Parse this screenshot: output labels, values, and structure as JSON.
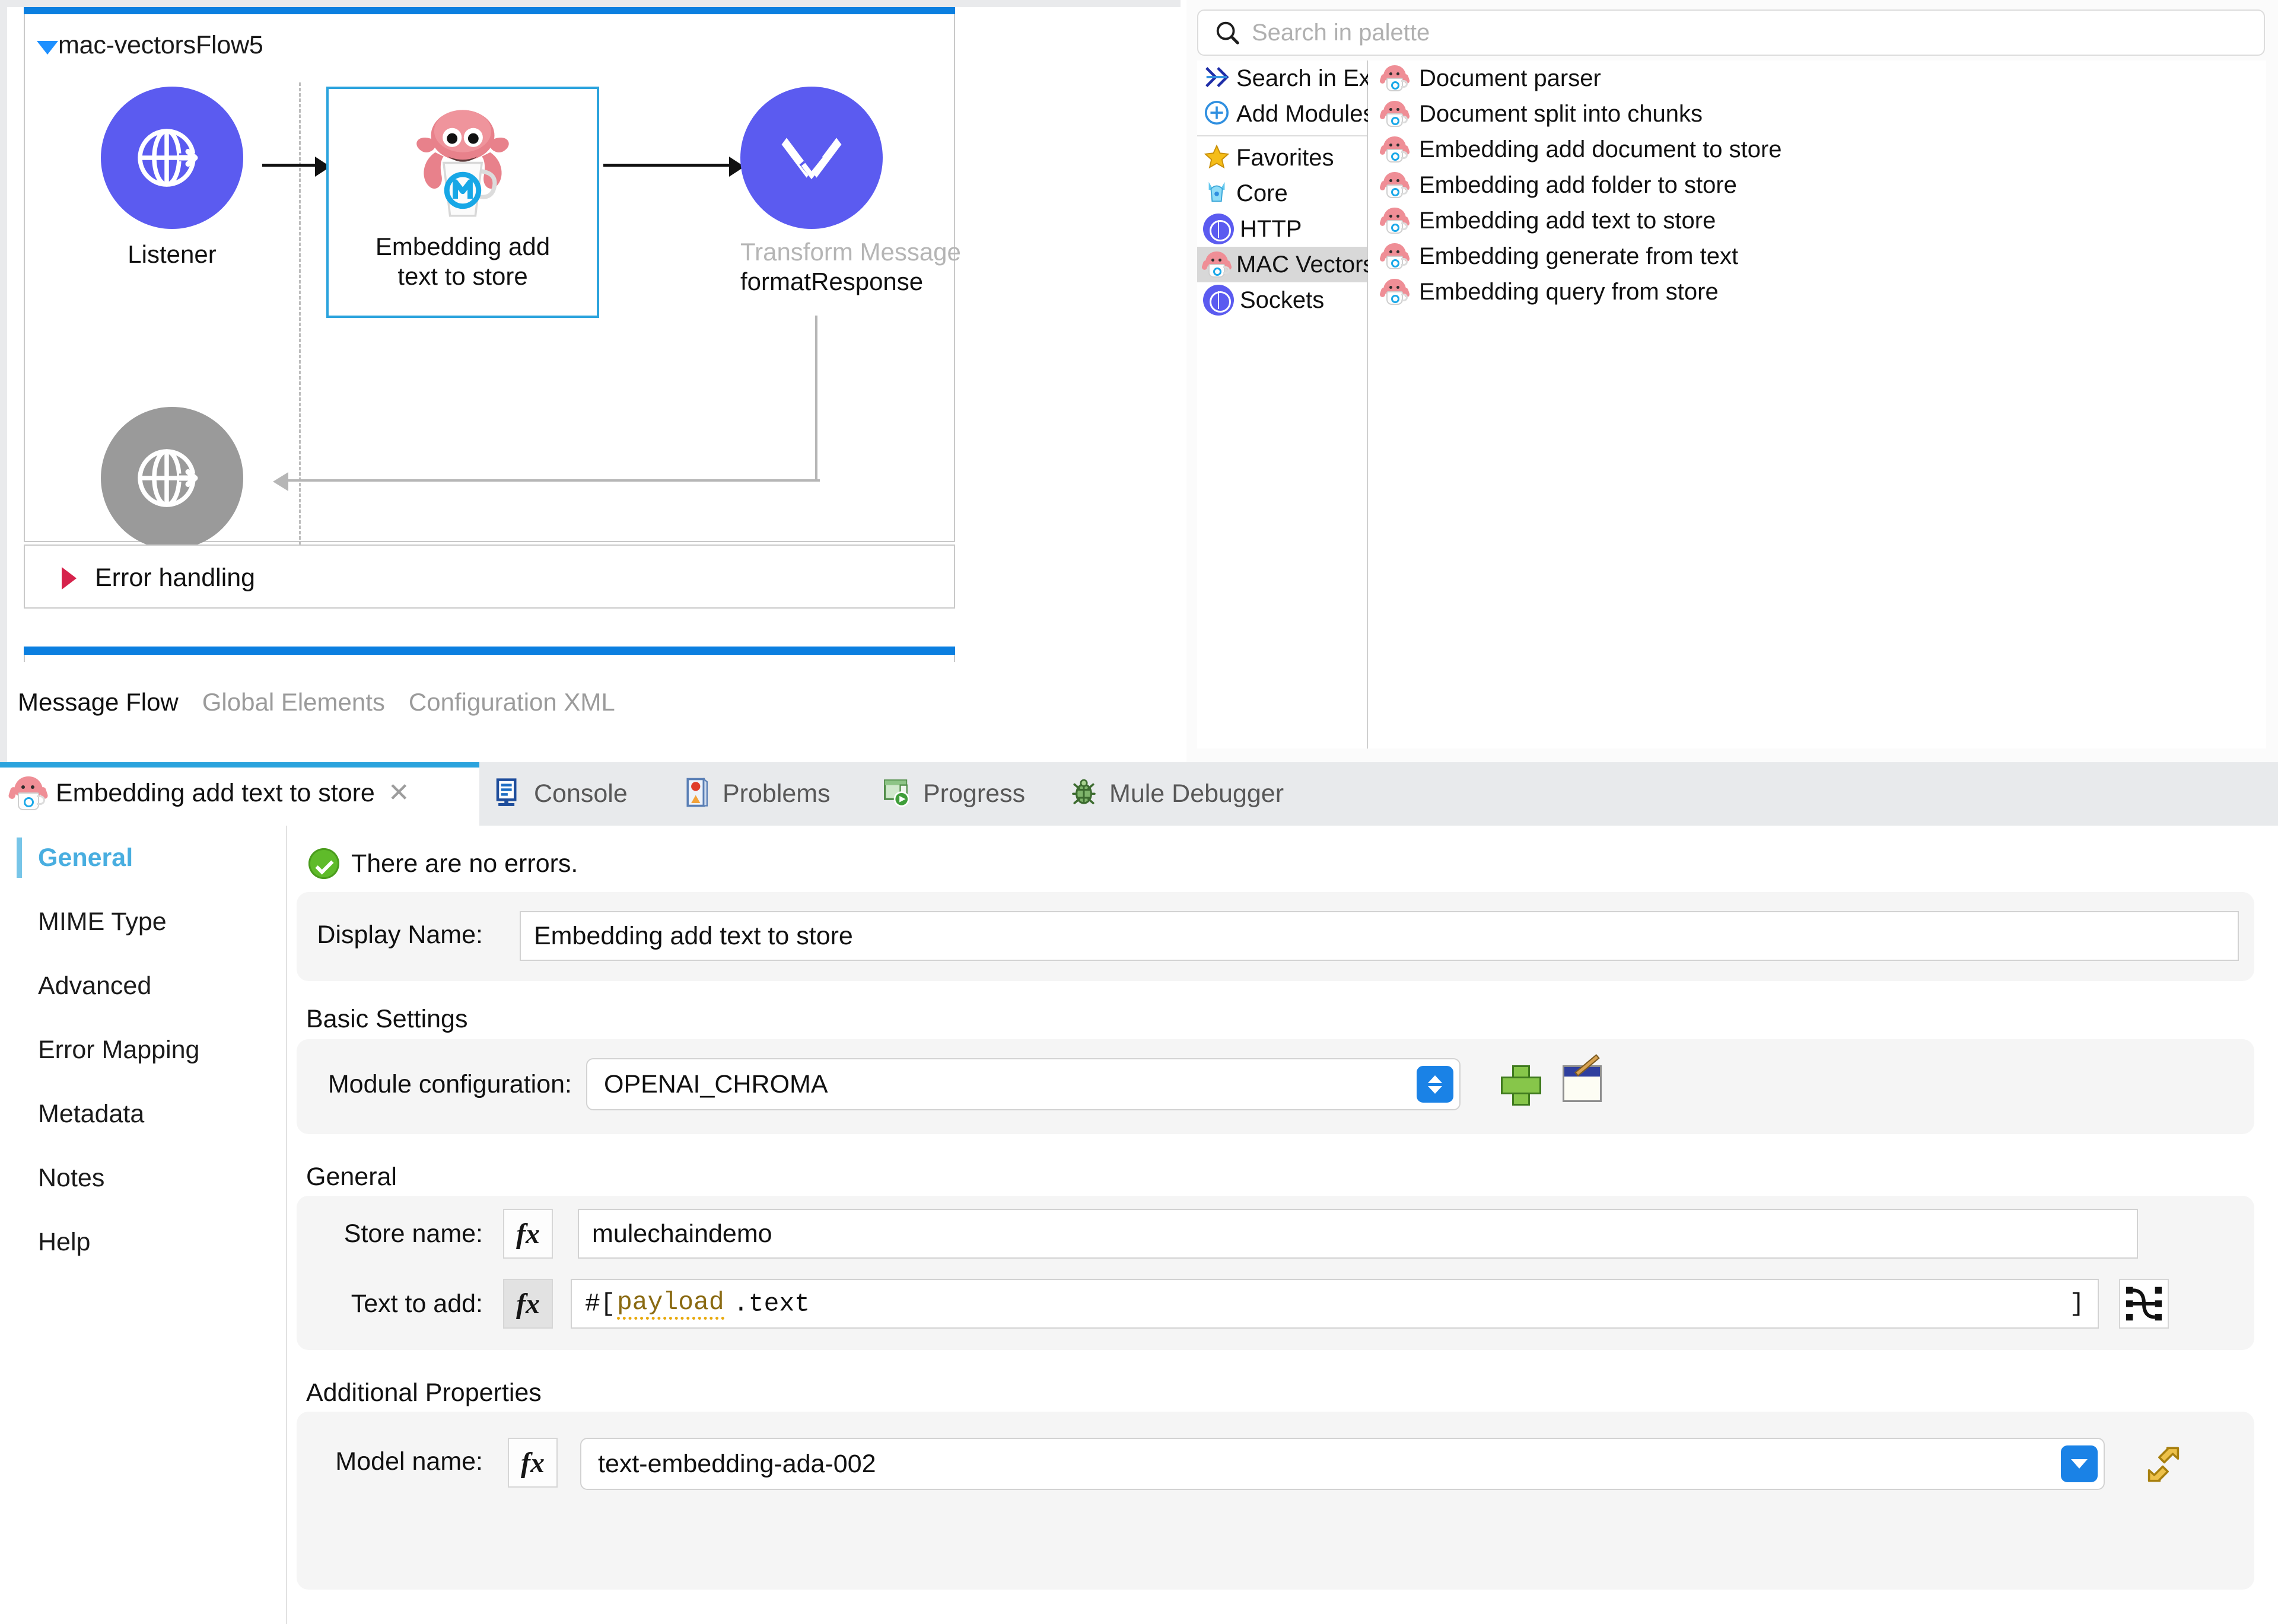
{
  "canvas": {
    "flow_name": "mac-vectorsFlow5",
    "nodes": [
      {
        "id": "listener",
        "label": "Listener",
        "icon": "globe-arrow-icon",
        "state": "enabled"
      },
      {
        "id": "embedding-add-text-to-store",
        "label_line1": "Embedding add",
        "label_line2": "text to store",
        "icon": "mac-octopus-icon",
        "state": "selected"
      },
      {
        "id": "transform-message",
        "label_line1": "Transform Message",
        "label_line2": "formatResponse",
        "icon": "dataweave-icon",
        "state": "enabled"
      },
      {
        "id": "listener-response",
        "label": "",
        "icon": "globe-arrow-icon",
        "state": "disabled"
      }
    ],
    "error_handling_label": "Error handling",
    "editor_tabs": [
      {
        "label": "Message Flow",
        "selected": true
      },
      {
        "label": "Global Elements",
        "selected": false
      },
      {
        "label": "Configuration XML",
        "selected": false
      }
    ]
  },
  "palette": {
    "search_placeholder": "Search in palette",
    "search_value": "",
    "categories": [
      {
        "label": "Search in Exchange..",
        "icon": "exchange-icon",
        "selected": false
      },
      {
        "label": "Add Modules",
        "icon": "plus-circle-icon",
        "selected": false
      },
      {
        "label": "Favorites",
        "icon": "star-icon",
        "selected": false
      },
      {
        "label": "Core",
        "icon": "core-icon",
        "selected": false
      },
      {
        "label": "HTTP",
        "icon": "globe-icon",
        "selected": false
      },
      {
        "label": "MAC Vectors",
        "icon": "mac-octopus-icon",
        "selected": true
      },
      {
        "label": "Sockets",
        "icon": "globe-icon",
        "selected": false
      }
    ],
    "operations": [
      {
        "label": "Document parser",
        "icon": "mac-octopus-icon"
      },
      {
        "label": "Document split into chunks",
        "icon": "mac-octopus-icon"
      },
      {
        "label": "Embedding add document to store",
        "icon": "mac-octopus-icon"
      },
      {
        "label": "Embedding add folder to store",
        "icon": "mac-octopus-icon"
      },
      {
        "label": "Embedding add text to store",
        "icon": "mac-octopus-icon"
      },
      {
        "label": "Embedding generate from text",
        "icon": "mac-octopus-icon"
      },
      {
        "label": "Embedding query from store",
        "icon": "mac-octopus-icon"
      }
    ]
  },
  "properties": {
    "active_tab": {
      "label": "Embedding add text to store",
      "icon": "mac-octopus-icon",
      "close": "✕"
    },
    "other_tabs": [
      {
        "label": "Console",
        "icon": "console-icon"
      },
      {
        "label": "Problems",
        "icon": "problems-icon"
      },
      {
        "label": "Progress",
        "icon": "progress-icon"
      },
      {
        "label": "Mule Debugger",
        "icon": "bug-icon"
      }
    ],
    "sidebar": [
      {
        "label": "General",
        "selected": true
      },
      {
        "label": "MIME Type",
        "selected": false
      },
      {
        "label": "Advanced",
        "selected": false
      },
      {
        "label": "Error Mapping",
        "selected": false
      },
      {
        "label": "Metadata",
        "selected": false
      },
      {
        "label": "Notes",
        "selected": false
      },
      {
        "label": "Help",
        "selected": false
      }
    ],
    "status": {
      "text": "There are no errors.",
      "icon": "check-circle-icon"
    },
    "display_name": {
      "label": "Display Name:",
      "value": "Embedding add text to store"
    },
    "sections": {
      "basic_settings": {
        "title": "Basic Settings"
      },
      "general": {
        "title": "General"
      },
      "additional_properties": {
        "title": "Additional Properties"
      }
    },
    "module_configuration": {
      "label": "Module configuration:",
      "value": "OPENAI_CHROMA",
      "add_icon": "plus-green-icon",
      "edit_icon": "edit-config-icon"
    },
    "store_name": {
      "label": "Store name:",
      "value": "mulechaindemo",
      "fx_active": false,
      "fx_label": "fx"
    },
    "text_to_add": {
      "label": "Text to add:",
      "prefix": "#[",
      "token": "payload",
      "rest": ".text",
      "suffix": "]",
      "fx_active": true,
      "fx_label": "fx",
      "mapper_icon": "datasense-mapper-icon"
    },
    "model_name": {
      "label": "Model name:",
      "value": "text-embedding-ada-002",
      "fx_active": false,
      "fx_label": "fx",
      "refresh_icon": "refresh-metadata-icon"
    }
  },
  "colors": {
    "accent_blue": "#0b7fe0",
    "selection_blue": "#2ba3dd",
    "node_purple": "#5b5bf0",
    "node_grey": "#9a9a9a",
    "error_red": "#d6224b",
    "success_green": "#5fbb2a",
    "expression_amber": "#8a6a12",
    "control_blue": "#1a82e6"
  }
}
